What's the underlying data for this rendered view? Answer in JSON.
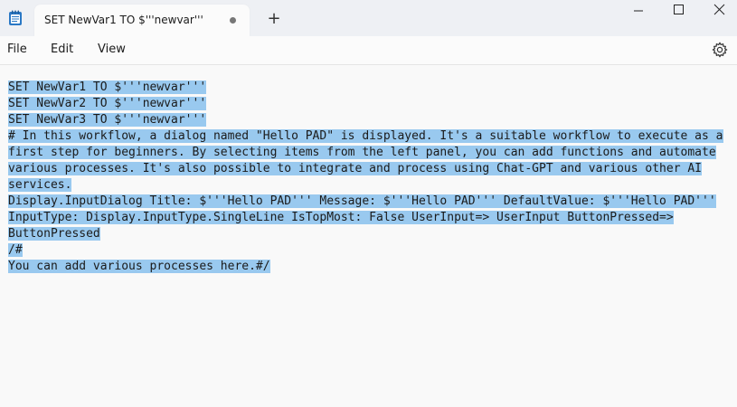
{
  "window": {
    "tab_title": "SET NewVar1 TO $'''newvar'''",
    "new_tab_symbol": "+",
    "app_icon": "notepad-icon",
    "controls": [
      "minimize-icon",
      "maximize-icon",
      "close-icon"
    ]
  },
  "menu": {
    "file": "File",
    "edit": "Edit",
    "view": "View",
    "settings_icon": "gear-icon"
  },
  "editor": {
    "selection_color": "#99c9ef",
    "lines": [
      "SET NewVar1 TO $'''newvar'''",
      "SET NewVar2 TO $'''newvar'''",
      "SET NewVar3 TO $'''newvar'''",
      "# In this workflow, a dialog named \"Hello PAD\" is displayed. It's a suitable workflow to execute as a",
      "first step for beginners. By selecting items from the left panel, you can add functions and automate",
      "various processes. It's also possible to integrate and process using Chat-GPT and various other AI",
      "services.",
      "Display.InputDialog Title: $'''Hello PAD''' Message: $'''Hello PAD''' DefaultValue: $'''Hello PAD'''",
      "InputType: Display.InputType.SingleLine IsTopMost: False UserInput=> UserInput ButtonPressed=>",
      "ButtonPressed",
      "/#",
      "You can add various processes here.#/"
    ]
  }
}
